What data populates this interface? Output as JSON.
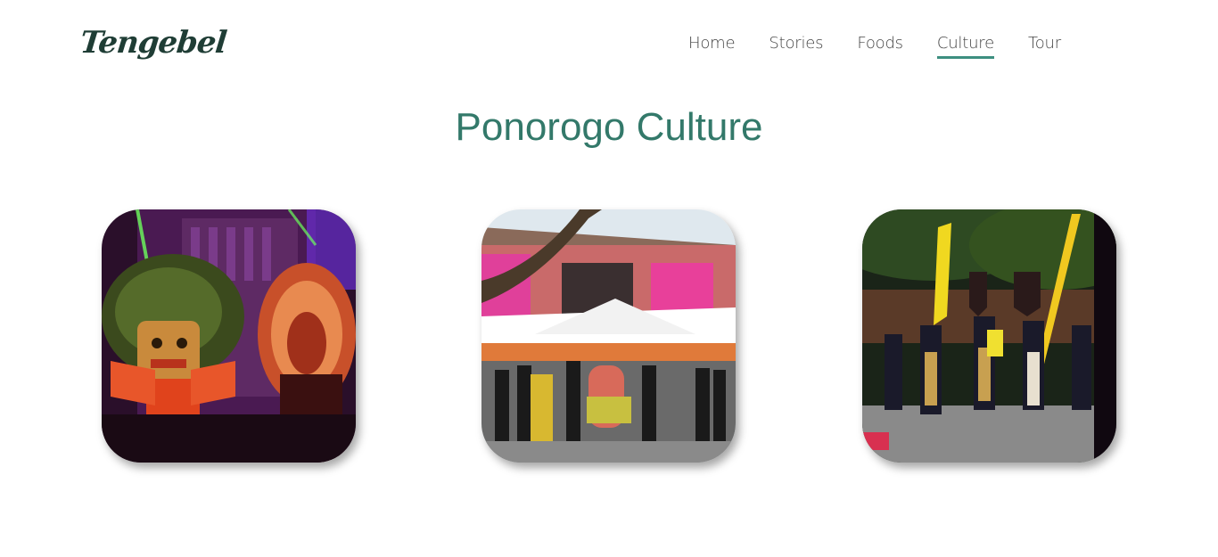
{
  "brand": {
    "logo_text": "Tengebel"
  },
  "nav": {
    "items": [
      {
        "label": "Home",
        "active": false
      },
      {
        "label": "Stories",
        "active": false
      },
      {
        "label": "Foods",
        "active": false
      },
      {
        "label": "Culture",
        "active": true
      },
      {
        "label": "Tour",
        "active": false
      }
    ],
    "active_underline_color": "#3d8f80"
  },
  "page": {
    "title": "Ponorogo Culture",
    "title_color": "#33796a"
  },
  "gallery": {
    "photos": [
      {
        "subject": "reog-dancer-photo"
      },
      {
        "subject": "ceremony-procession-photo"
      },
      {
        "subject": "flag-bearers-photo"
      }
    ]
  }
}
